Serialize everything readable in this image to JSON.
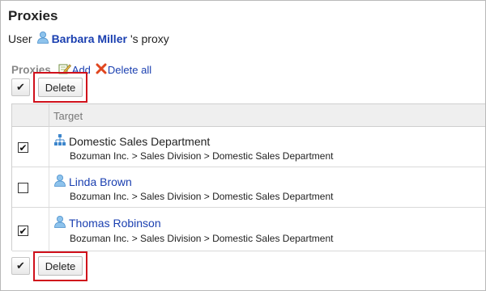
{
  "page": {
    "title": "Proxies",
    "subtitle_prefix": "User",
    "user_name": "Barbara Miller",
    "subtitle_suffix": "'s proxy"
  },
  "section": {
    "label": "Proxies",
    "add_label": "Add",
    "delete_all_label": "Delete all"
  },
  "controls": {
    "check_all_glyph": "✔",
    "delete_label": "Delete"
  },
  "table": {
    "header": "Target",
    "rows": [
      {
        "checked": true,
        "type": "department",
        "icon": "organization-icon",
        "name": "Domestic Sales Department",
        "path": "Bozuman Inc. > Sales Division > Domestic Sales Department"
      },
      {
        "checked": false,
        "type": "user",
        "icon": "user-icon",
        "name": "Linda Brown",
        "path": "Bozuman Inc. > Sales Division > Domestic Sales Department"
      },
      {
        "checked": true,
        "type": "user",
        "icon": "user-icon",
        "name": "Thomas Robinson",
        "path": "Bozuman Inc. > Sales Division > Domestic Sales Department"
      }
    ]
  },
  "colors": {
    "link": "#1a3fb0",
    "highlight": "#d0101b",
    "header_bg": "#efefef"
  }
}
